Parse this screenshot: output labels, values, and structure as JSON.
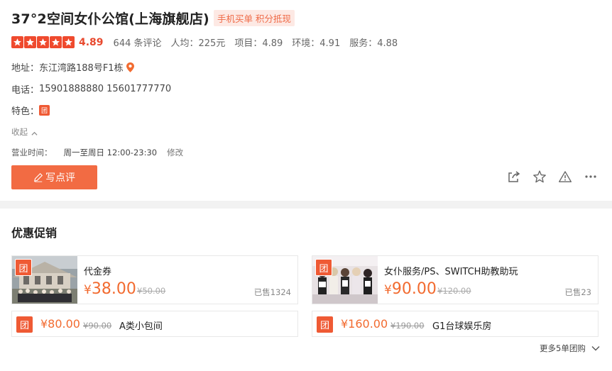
{
  "shop": {
    "title": "37°2空间女仆公馆(上海旗舰店)",
    "tag": "手机买单 积分抵现",
    "score": "4.89",
    "review_count": "644 条评论",
    "avg_price": "人均：225元",
    "item_score": "项目：4.89",
    "env_score": "环境：4.91",
    "service_score": "服务：4.88",
    "address_label": "地址：",
    "address": "东江湾路188号F1栋",
    "phone_label": "电话：",
    "phone": "15901888880 15601777770",
    "feature_label": "特色：",
    "feature_badge": "团",
    "collapse": "收起",
    "hours_label": "营业时间：",
    "hours": "周一至周日 12:00-23:30",
    "hours_edit": "修改",
    "write_review": "写点评"
  },
  "promo": {
    "title": "优惠促销",
    "more": "更多5单团购",
    "badge": "团",
    "deals": [
      {
        "name": "代金券",
        "currency": "¥",
        "price": "38.00",
        "original": "¥50.00",
        "sold": "已售1324"
      },
      {
        "name": "女仆服务/PS、SWITCH助教助玩",
        "currency": "¥",
        "price": "90.00",
        "original": "¥120.00",
        "sold": "已售23"
      }
    ],
    "small_deals": [
      {
        "price": "¥80.00",
        "original": "¥90.00",
        "name": "A类小包间"
      },
      {
        "price": "¥160.00",
        "original": "¥190.00",
        "name": "G1台球娱乐房"
      }
    ]
  },
  "colors": {
    "accent": "#f26b43",
    "star": "#ef4a2e",
    "price": "#f26b30",
    "tag_bg": "#fde9e4"
  },
  "icons": [
    "star-icon",
    "location-pin-icon",
    "chevron-up-icon",
    "pencil-icon",
    "share-icon",
    "favorite-star-icon",
    "report-warning-icon",
    "more-dots-icon",
    "chevron-down-icon"
  ]
}
